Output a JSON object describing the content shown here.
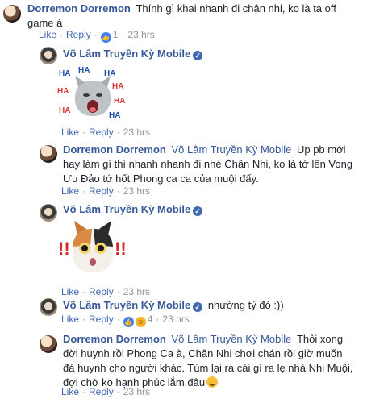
{
  "comments": [
    {
      "author": "Dorremon Dorremon",
      "text": "Thính gì khai nhanh đi chân nhi, ko là ta off game à",
      "like": "Like",
      "reply": "Reply",
      "reaction_count": "1",
      "time": "23 hrs"
    },
    {
      "author": "Võ Lâm Truyền Kỳ Mobile",
      "sticker": "laughing-cat-haha-sticker",
      "sticker_text": "HA",
      "like": "Like",
      "reply": "Reply",
      "time": "23 hrs"
    },
    {
      "author": "Dorremon Dorremon",
      "mention": "Võ Lâm Truyền Kỳ Mobile",
      "text": "Up pb mới hay làm gì thì nhanh nhanh đi nhé Chân Nhi, ko là tớ lên Vong Ưu Đảo tớ hốt Phong ca ca của muội đấy.",
      "like": "Like",
      "reply": "Reply",
      "time": "23 hrs"
    },
    {
      "author": "Võ Lâm Truyền Kỳ Mobile",
      "sticker": "shocked-cat-sticker",
      "sticker_text": "!!",
      "like": "Like",
      "reply": "Reply",
      "time": "23 hrs"
    },
    {
      "author": "Võ Lâm Truyền Kỳ Mobile",
      "text": "nhường tỷ đó :))",
      "like": "Like",
      "reply": "Reply",
      "reaction_count": "4",
      "time": "23 hrs"
    },
    {
      "author": "Dorremon Dorremon",
      "mention": "Võ Lâm Truyền Kỳ Mobile",
      "text": "Thôi xong đời huynh rồi Phong Ca à, Chân Nhi chơi chán rồi giờ muốn đá huynh cho người khác. Túm lại ra cái gì ra lẹ nhá Nhi Muội, đợi chờ ko hạnh phúc lắm đâu",
      "like": "Like",
      "reply": "Reply",
      "time": "23 hrs"
    }
  ],
  "separator": "·",
  "colors": {
    "link": "#365899",
    "action": "#4267b2",
    "meta": "#90949c",
    "text": "#1d2129"
  }
}
